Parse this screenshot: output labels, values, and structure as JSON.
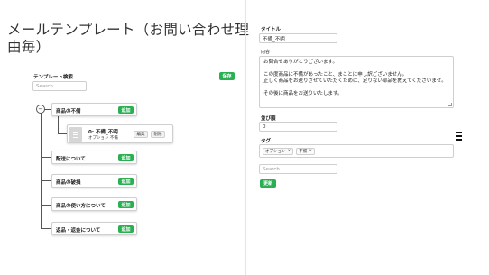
{
  "page": {
    "title": "メールテンプレート（お問い合わせ理由毎）"
  },
  "left": {
    "search_label": "テンプレート検索",
    "search_placeholder": "Search...",
    "save_label": "保存",
    "tree": {
      "toggle_symbol": "−",
      "root_nodes": [
        {
          "label": "商品の不備",
          "add_label": "追加",
          "expanded": true
        },
        {
          "label": "配送について",
          "add_label": "追加"
        },
        {
          "label": "商品の破損",
          "add_label": "追加"
        },
        {
          "label": "商品の使い方について",
          "add_label": "追加"
        },
        {
          "label": "返品・返金について",
          "add_label": "追加"
        }
      ],
      "child": {
        "title": "0: 不備_不明",
        "subtitle": "オプション 不備",
        "edit_label": "編集",
        "delete_label": "削除"
      }
    }
  },
  "right": {
    "title_label": "タイトル",
    "title_value": "不備_不明",
    "body_label": "内容",
    "body_lines": [
      "お問合せありがとうございます。",
      "",
      "この度商品に不備があったこと、まことに申し訳ございません。",
      "正しく商品をお送りさせていただくために、足りない部品を教えてくださいませ。",
      "",
      "その後に商品をお送りいたします。"
    ],
    "order_label": "並び順",
    "order_value": "0",
    "tag_label": "タグ",
    "tags": [
      {
        "label": "オプション",
        "remove": "×"
      },
      {
        "label": "不備",
        "remove": "×"
      }
    ],
    "tag_search_placeholder": "Search...",
    "update_label": "更新"
  },
  "colors": {
    "accent_green": "#2ab052",
    "border": "#cfcfcf"
  }
}
